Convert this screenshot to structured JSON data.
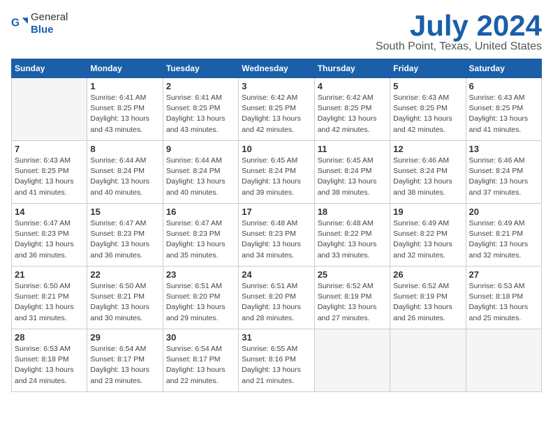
{
  "header": {
    "logo_general": "General",
    "logo_blue": "Blue",
    "title": "July 2024",
    "subtitle": "South Point, Texas, United States"
  },
  "weekdays": [
    "Sunday",
    "Monday",
    "Tuesday",
    "Wednesday",
    "Thursday",
    "Friday",
    "Saturday"
  ],
  "weeks": [
    [
      {
        "day": "",
        "info": ""
      },
      {
        "day": "1",
        "info": "Sunrise: 6:41 AM\nSunset: 8:25 PM\nDaylight: 13 hours\nand 43 minutes."
      },
      {
        "day": "2",
        "info": "Sunrise: 6:41 AM\nSunset: 8:25 PM\nDaylight: 13 hours\nand 43 minutes."
      },
      {
        "day": "3",
        "info": "Sunrise: 6:42 AM\nSunset: 8:25 PM\nDaylight: 13 hours\nand 42 minutes."
      },
      {
        "day": "4",
        "info": "Sunrise: 6:42 AM\nSunset: 8:25 PM\nDaylight: 13 hours\nand 42 minutes."
      },
      {
        "day": "5",
        "info": "Sunrise: 6:43 AM\nSunset: 8:25 PM\nDaylight: 13 hours\nand 42 minutes."
      },
      {
        "day": "6",
        "info": "Sunrise: 6:43 AM\nSunset: 8:25 PM\nDaylight: 13 hours\nand 41 minutes."
      }
    ],
    [
      {
        "day": "7",
        "info": "Sunrise: 6:43 AM\nSunset: 8:25 PM\nDaylight: 13 hours\nand 41 minutes."
      },
      {
        "day": "8",
        "info": "Sunrise: 6:44 AM\nSunset: 8:24 PM\nDaylight: 13 hours\nand 40 minutes."
      },
      {
        "day": "9",
        "info": "Sunrise: 6:44 AM\nSunset: 8:24 PM\nDaylight: 13 hours\nand 40 minutes."
      },
      {
        "day": "10",
        "info": "Sunrise: 6:45 AM\nSunset: 8:24 PM\nDaylight: 13 hours\nand 39 minutes."
      },
      {
        "day": "11",
        "info": "Sunrise: 6:45 AM\nSunset: 8:24 PM\nDaylight: 13 hours\nand 38 minutes."
      },
      {
        "day": "12",
        "info": "Sunrise: 6:46 AM\nSunset: 8:24 PM\nDaylight: 13 hours\nand 38 minutes."
      },
      {
        "day": "13",
        "info": "Sunrise: 6:46 AM\nSunset: 8:24 PM\nDaylight: 13 hours\nand 37 minutes."
      }
    ],
    [
      {
        "day": "14",
        "info": "Sunrise: 6:47 AM\nSunset: 8:23 PM\nDaylight: 13 hours\nand 36 minutes."
      },
      {
        "day": "15",
        "info": "Sunrise: 6:47 AM\nSunset: 8:23 PM\nDaylight: 13 hours\nand 36 minutes."
      },
      {
        "day": "16",
        "info": "Sunrise: 6:47 AM\nSunset: 8:23 PM\nDaylight: 13 hours\nand 35 minutes."
      },
      {
        "day": "17",
        "info": "Sunrise: 6:48 AM\nSunset: 8:23 PM\nDaylight: 13 hours\nand 34 minutes."
      },
      {
        "day": "18",
        "info": "Sunrise: 6:48 AM\nSunset: 8:22 PM\nDaylight: 13 hours\nand 33 minutes."
      },
      {
        "day": "19",
        "info": "Sunrise: 6:49 AM\nSunset: 8:22 PM\nDaylight: 13 hours\nand 32 minutes."
      },
      {
        "day": "20",
        "info": "Sunrise: 6:49 AM\nSunset: 8:21 PM\nDaylight: 13 hours\nand 32 minutes."
      }
    ],
    [
      {
        "day": "21",
        "info": "Sunrise: 6:50 AM\nSunset: 8:21 PM\nDaylight: 13 hours\nand 31 minutes."
      },
      {
        "day": "22",
        "info": "Sunrise: 6:50 AM\nSunset: 8:21 PM\nDaylight: 13 hours\nand 30 minutes."
      },
      {
        "day": "23",
        "info": "Sunrise: 6:51 AM\nSunset: 8:20 PM\nDaylight: 13 hours\nand 29 minutes."
      },
      {
        "day": "24",
        "info": "Sunrise: 6:51 AM\nSunset: 8:20 PM\nDaylight: 13 hours\nand 28 minutes."
      },
      {
        "day": "25",
        "info": "Sunrise: 6:52 AM\nSunset: 8:19 PM\nDaylight: 13 hours\nand 27 minutes."
      },
      {
        "day": "26",
        "info": "Sunrise: 6:52 AM\nSunset: 8:19 PM\nDaylight: 13 hours\nand 26 minutes."
      },
      {
        "day": "27",
        "info": "Sunrise: 6:53 AM\nSunset: 8:18 PM\nDaylight: 13 hours\nand 25 minutes."
      }
    ],
    [
      {
        "day": "28",
        "info": "Sunrise: 6:53 AM\nSunset: 8:18 PM\nDaylight: 13 hours\nand 24 minutes."
      },
      {
        "day": "29",
        "info": "Sunrise: 6:54 AM\nSunset: 8:17 PM\nDaylight: 13 hours\nand 23 minutes."
      },
      {
        "day": "30",
        "info": "Sunrise: 6:54 AM\nSunset: 8:17 PM\nDaylight: 13 hours\nand 22 minutes."
      },
      {
        "day": "31",
        "info": "Sunrise: 6:55 AM\nSunset: 8:16 PM\nDaylight: 13 hours\nand 21 minutes."
      },
      {
        "day": "",
        "info": ""
      },
      {
        "day": "",
        "info": ""
      },
      {
        "day": "",
        "info": ""
      }
    ]
  ]
}
